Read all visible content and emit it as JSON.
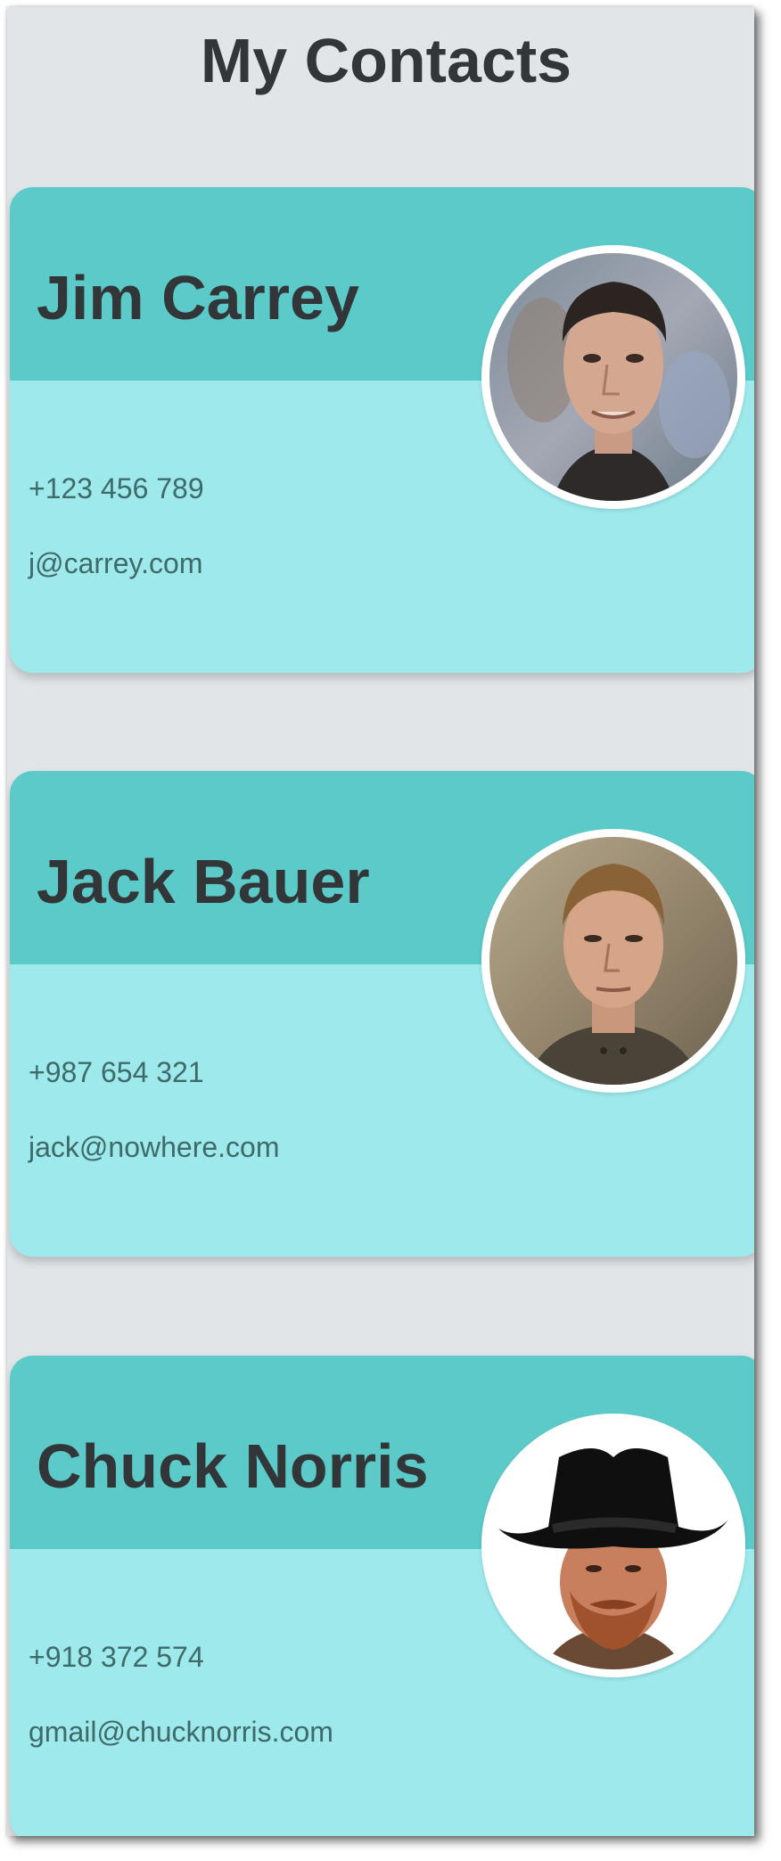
{
  "page": {
    "title": "My Contacts"
  },
  "contacts": [
    {
      "name": "Jim Carrey",
      "phone": "+123 456 789",
      "email": "j@carrey.com",
      "avatar_icon": "portrait-photo-jim-carrey"
    },
    {
      "name": "Jack Bauer",
      "phone": "+987 654 321",
      "email": "jack@nowhere.com",
      "avatar_icon": "portrait-photo-jack-bauer"
    },
    {
      "name": "Chuck Norris",
      "phone": "+918 372 574",
      "email": "gmail@chucknorris.com",
      "avatar_icon": "portrait-photo-chuck-norris"
    }
  ],
  "colors": {
    "background": "#e1e5e8",
    "card_header": "#5ccac8",
    "card_body": "#9de9ec",
    "title_text": "#333638",
    "detail_text": "#3f6a6a"
  }
}
